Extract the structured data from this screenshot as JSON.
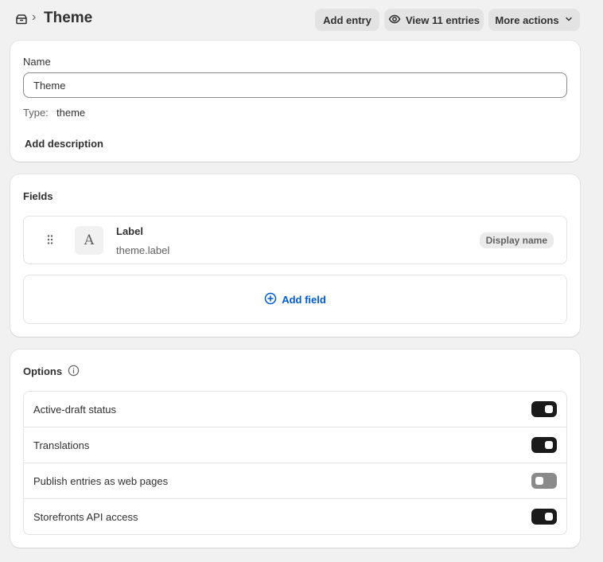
{
  "header": {
    "breadcrumb_icon": "metaobject-icon",
    "separator": "›",
    "title": "Theme",
    "add_entry": "Add entry",
    "view_entries": "View 11 entries",
    "more_actions": "More actions"
  },
  "definition": {
    "name_label": "Name",
    "name_value": "Theme",
    "type_label": "Type:",
    "type_value": "theme",
    "add_description": "Add description"
  },
  "fields": {
    "title": "Fields",
    "items": [
      {
        "type_glyph": "A",
        "name": "Label",
        "key": "theme.label",
        "badge": "Display name"
      }
    ],
    "add_field": "Add field"
  },
  "options": {
    "title": "Options",
    "items": [
      {
        "label": "Active-draft status",
        "enabled": true
      },
      {
        "label": "Translations",
        "enabled": true
      },
      {
        "label": "Publish entries as web pages",
        "enabled": false
      },
      {
        "label": "Storefronts API access",
        "enabled": true
      }
    ]
  },
  "colors": {
    "accent_link": "#005bd3",
    "toggle_on": "#1a1a1a",
    "toggle_off": "#8a8a8a",
    "background": "#f1f1f1"
  }
}
